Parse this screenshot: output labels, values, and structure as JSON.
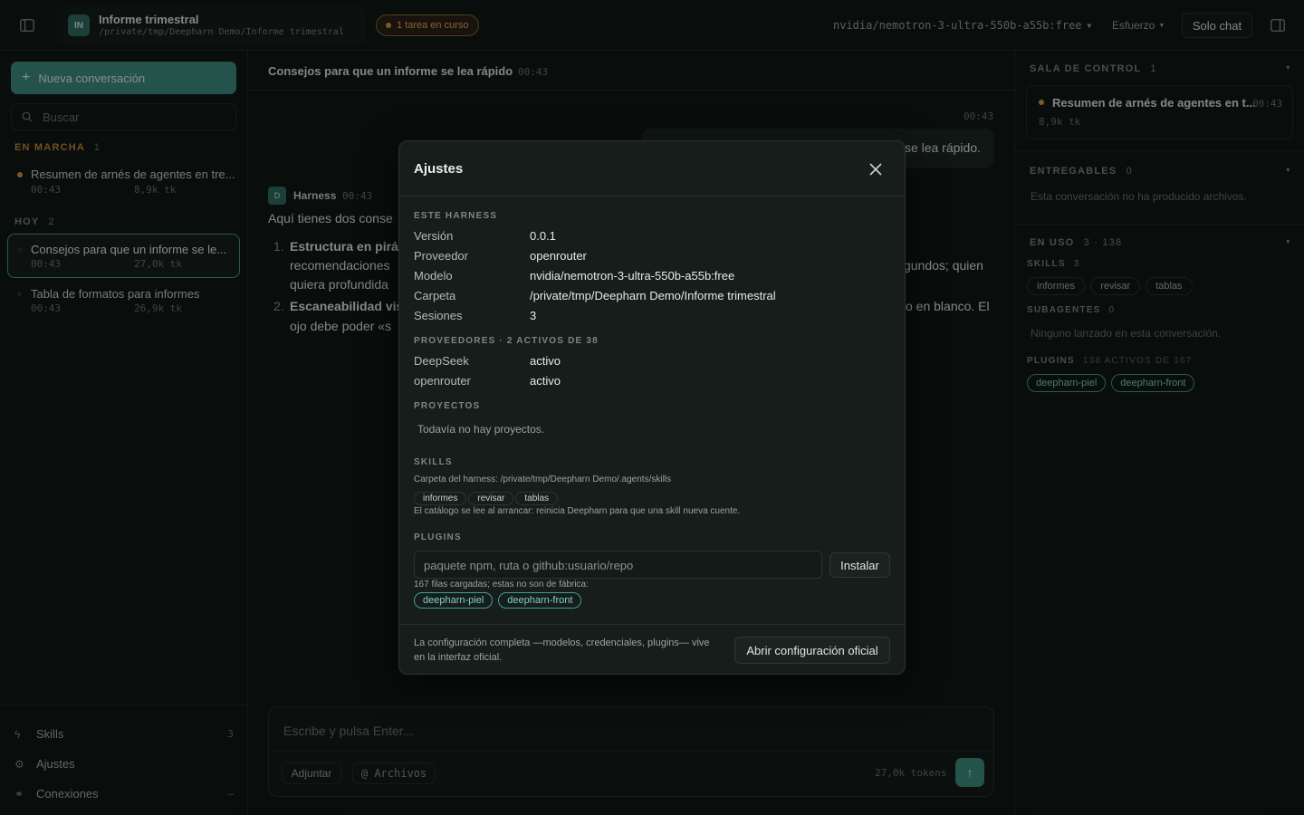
{
  "topbar": {
    "project_initials": "IN",
    "project_title": "Informe trimestral",
    "project_path": "/private/tmp/Deepharn Demo/Informe trimestral",
    "task_badge": "1 tarea en curso",
    "model": "nvidia/nemotron-3-ultra-550b-a55b:free",
    "effort": "Esfuerzo",
    "chat_only": "Solo chat"
  },
  "sidebar": {
    "new_chat": "Nueva conversación",
    "search_placeholder": "Buscar",
    "running_label": "EN MARCHA",
    "running_count": "1",
    "running_items": [
      {
        "title": "Resumen de arnés de agentes en tre...",
        "time": "00:43",
        "tokens": "8,9k tk"
      }
    ],
    "today_label": "HOY",
    "today_count": "2",
    "today_items": [
      {
        "title": "Consejos para que un informe se le...",
        "time": "00:43",
        "tokens": "27,0k tk"
      },
      {
        "title": "Tabla de formatos para informes",
        "time": "00:43",
        "tokens": "26,9k tk"
      }
    ],
    "bottom": {
      "skills": "Skills",
      "skills_count": "3",
      "settings": "Ajustes",
      "connections": "Conexiones",
      "connections_count": "–"
    }
  },
  "main": {
    "title": "Consejos para que un informe se lea rápido",
    "title_time": "00:43",
    "user_time": "00:43",
    "user_msg_tail": "se lea rápido.",
    "assistant_initial": "D",
    "assistant_name": "Harness",
    "assistant_time": "00:43",
    "assistant_intro": "Aquí tienes dos conse",
    "item1_num": "1.",
    "item1_bold": "Estructura en pirá",
    "item1_line2": "recomendaciones",
    "item1_line2_tail": "gundos; quien",
    "item1_line3": "quiera profundida",
    "item2_num": "2.",
    "item2_bold": "Escaneabilidad vis",
    "item2_tail": "o en blanco. El",
    "item2_line2": "ojo debe poder «s",
    "composer_placeholder": "Escribe y pulsa Enter...",
    "attach": "Adjuntar",
    "files": "@ Archivos",
    "tokens": "27,0k tokens"
  },
  "right": {
    "control_label": "SALA DE CONTROL",
    "control_count": "1",
    "control_item_title": "Resumen de arnés de agentes en t...",
    "control_item_time": "00:43",
    "control_item_tokens": "8,9k tk",
    "deliverables_label": "ENTREGABLES",
    "deliverables_count": "0",
    "deliverables_empty": "Esta conversación no ha producido archivos.",
    "inuse_label": "EN USO",
    "inuse_count": "3 · 138",
    "skills_label": "SKILLS",
    "skills_count": "3",
    "skills": [
      "informes",
      "revisar",
      "tablas"
    ],
    "subagents_label": "SUBAGENTES",
    "subagents_count": "0",
    "subagents_empty": "Ninguno lanzado en esta conversación.",
    "plugins_label": "PLUGINS",
    "plugins_count": "138 ACTIVOS DE 167",
    "plugins": [
      "deepharn-piel",
      "deepharn-front"
    ]
  },
  "modal": {
    "title": "Ajustes",
    "harness_label": "ESTE HARNESS",
    "harness_rows": [
      {
        "k": "Versión",
        "v": "0.0.1"
      },
      {
        "k": "Proveedor",
        "v": "openrouter"
      },
      {
        "k": "Modelo",
        "v": "nvidia/nemotron-3-ultra-550b-a55b:free"
      },
      {
        "k": "Carpeta",
        "v": "/private/tmp/Deepharn Demo/Informe trimestral"
      },
      {
        "k": "Sesiones",
        "v": "3"
      }
    ],
    "providers_label": "PROVEEDORES · 2 ACTIVOS DE 38",
    "providers_rows": [
      {
        "k": "DeepSeek",
        "v": "activo"
      },
      {
        "k": "openrouter",
        "v": "activo"
      }
    ],
    "projects_label": "PROYECTOS",
    "projects_empty": "Todavía no hay proyectos.",
    "skills_label": "SKILLS",
    "skills_folder": "Carpeta del harness: /private/tmp/Deepharn Demo/.agents/skills",
    "skills": [
      "informes",
      "revisar",
      "tablas"
    ],
    "skills_note": "El catálogo se lee al arrancar: reinicia Deepharn para que una skill nueva cuente.",
    "plugins_label": "PLUGINS",
    "plugins_placeholder": "paquete npm, ruta o github:usuario/repo",
    "install": "Instalar",
    "plugins_note": "167 filas cargadas; estas no son de fábrica:",
    "plugins": [
      "deepharn-piel",
      "deepharn-front"
    ],
    "footer_note": "La configuración completa —modelos, credenciales, plugins— vive en la interfaz oficial.",
    "open_official": "Abrir configuración oficial"
  },
  "colors": {
    "accent": "#3f9f8e",
    "warning": "#d79a3c",
    "bg": "#111816"
  }
}
